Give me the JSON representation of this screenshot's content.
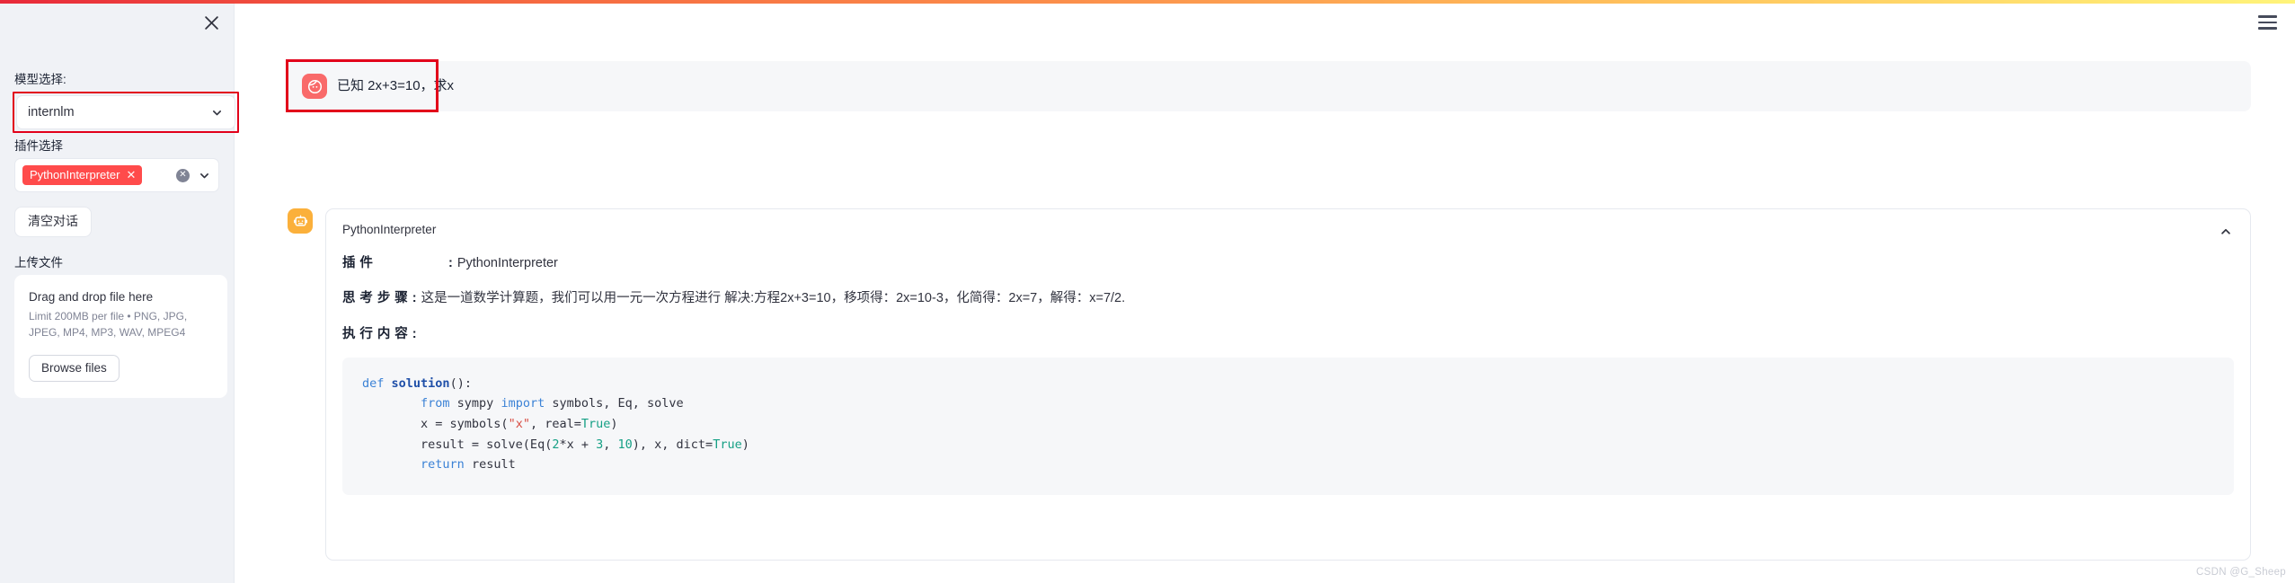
{
  "topbar": {
    "gradient_from": "#e8293a",
    "gradient_mid": "#fb8c4a",
    "gradient_to": "#fff47a",
    "menu_icon": "hamburger-menu-icon"
  },
  "sidebar": {
    "close_icon": "close-icon",
    "model_section": {
      "label": "模型选择:",
      "selected": "internlm",
      "chevron_icon": "chevron-down-icon",
      "highlight_color": "#e2001a"
    },
    "plugin_section": {
      "label": "插件选择",
      "tags": [
        {
          "label": "PythonInterpreter",
          "remove_icon": "x-icon",
          "color": "#ff4b4b"
        }
      ],
      "clear_icon": "clear-circle-icon",
      "chevron_icon": "chevron-down-icon"
    },
    "clear_chat_button": "清空对话",
    "upload_section": {
      "label": "上传文件",
      "dropzone_title": "Drag and drop file here",
      "dropzone_limits": "Limit 200MB per file • PNG, JPG, JPEG, MP4, MP3, WAV, MPEG4",
      "browse_button": "Browse files"
    }
  },
  "chat": {
    "user_message": {
      "avatar_icon": "user-face-icon",
      "avatar_color": "#f96a6a",
      "text": "已知 2x+3=10，求x",
      "highlighted": true
    },
    "assistant_message": {
      "avatar_icon": "robot-icon",
      "avatar_color": "#fbb03b",
      "card_title": "PythonInterpreter",
      "collapse_icon": "chevron-up-icon",
      "rows": [
        {
          "key": "插件",
          "value": "PythonInterpreter"
        },
        {
          "key": "思考步骤",
          "value": "这是一道数学计算题，我们可以用一元一次方程进行 解决:方程2x+3=10，移项得：2x=10-3，化简得：2x=7，解得：x=7/2."
        },
        {
          "key": "执行内容",
          "value": ""
        }
      ],
      "code": {
        "language": "python",
        "lines": [
          "def solution():",
          "        from sympy import symbols, Eq, solve",
          "        x = symbols(\"x\", real=True)",
          "        result = solve(Eq(2*x + 3, 10), x, dict=True)",
          "        return result"
        ]
      }
    }
  },
  "watermark": "CSDN @G_Sheep"
}
